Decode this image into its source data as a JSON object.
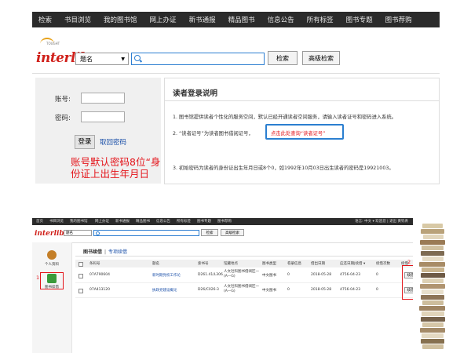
{
  "top": {
    "nav": [
      "检索",
      "书目浏览",
      "我的图书馆",
      "网上办证",
      "新书通报",
      "精品图书",
      "信息公告",
      "所有标签",
      "图书专题",
      "图书荐购"
    ],
    "logo": "interlib",
    "logo_small": "TOUGHT",
    "search": {
      "type_selected": "题名",
      "placeholder": "",
      "btn_search": "检索",
      "btn_advanced": "高级检索"
    },
    "login": {
      "account_label": "账号:",
      "password_label": "密码:",
      "login_btn": "登录",
      "retrieve_link": "取回密码"
    },
    "red_note": "账号默认密码8位“身份证上出生年月日",
    "info": {
      "title": "读者登录说明",
      "item1": "1. 图书馆提供读者个性化的服务空间，默认已经开通读者空间服务，请输入读者证号和密码进入系统。",
      "item2_prefix": "2. “读者证号”为读者图书借阅证号，",
      "item2_link": "点击此处查询“读者证号”",
      "item3": "3. 初始密码为读者的身份证出生年月日或8个0，如1992年10月03日出生读者的密码是19921003。"
    }
  },
  "bottom": {
    "nav": [
      "首页",
      "书目浏览",
      "我的图书馆",
      "网上办证",
      "新书通报",
      "精品图书",
      "信息公告",
      "所有标签",
      "图书专题",
      "图书荐购"
    ],
    "nav_right": "语言: 中文 ▾   欢迎您 | 退出 黄钨青",
    "logo": "interlib",
    "search": {
      "type_selected": "题名",
      "btn_search": "检索",
      "btn_advanced": "高级检索"
    },
    "sidebar": {
      "profile": "个人资料",
      "renew": "图书续借"
    },
    "tabs": {
      "active": "图书续借",
      "other": "专项续借"
    },
    "marks": {
      "one": "1",
      "two": "2"
    },
    "columns": [
      "条码号",
      "题名",
      "索书号",
      "馆藏地点",
      "图书类型",
      "卷册信息",
      "借出日期",
      "应还日期|续借 ▾",
      "续借次数",
      "续借"
    ],
    "rows": [
      {
        "barcode": "07A790604",
        "title": "新时期党校工作论",
        "callno": "D261.41/L306",
        "location": "人文社科图书借阅区一(A—G)",
        "type": "中文图书",
        "vol": "0",
        "loan": "2018-05-28",
        "due": "4756-04-23",
        "count": "0",
        "action": "续借"
      },
      {
        "barcode": "07A413120",
        "title": "执政党建设概论",
        "callno": "D26/C026-3",
        "location": "人文社科图书借阅区一(A—G)",
        "type": "中文图书",
        "vol": "0",
        "loan": "2018-05-28",
        "due": "4756-04-23",
        "count": "0",
        "action": "续借"
      }
    ]
  }
}
